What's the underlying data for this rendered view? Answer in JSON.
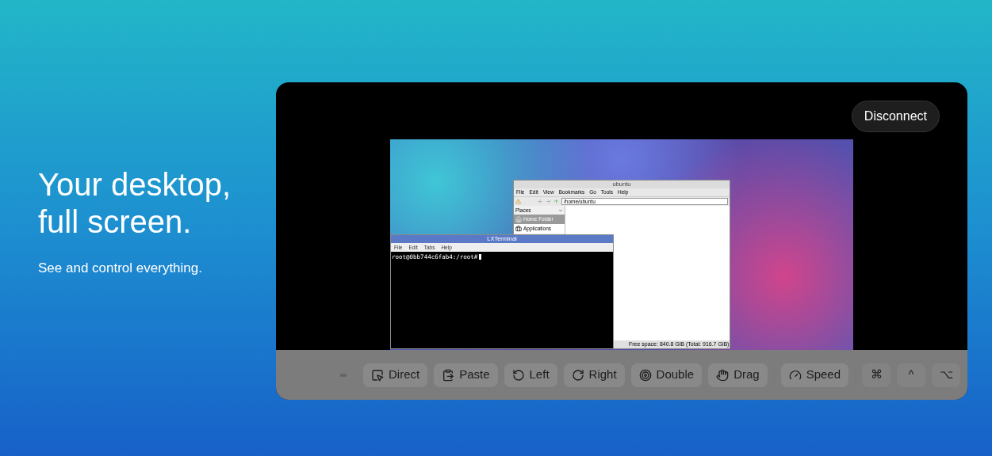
{
  "hero": {
    "title": "Your desktop, full screen.",
    "subtitle": "See and control everything."
  },
  "viewer": {
    "disconnect_button": "Disconnect",
    "remote_desktop": {
      "file_manager": {
        "title": "ubuntu",
        "menu": [
          "File",
          "Edit",
          "View",
          "Bookmarks",
          "Go",
          "Tools",
          "Help"
        ],
        "path": "/home/ubuntu",
        "places_header": "Places",
        "places": [
          {
            "label": "Home Folder",
            "selected": true
          },
          {
            "label": "Applications",
            "selected": false
          }
        ],
        "status": "Free space: 840.8 GiB (Total: 916.7 GiB)"
      },
      "terminal": {
        "title": "LXTerminal",
        "menu": [
          "File",
          "Edit",
          "Tabs",
          "Help"
        ],
        "prompt": "root@0bb744c6fab4:/root#"
      }
    },
    "toolbar": [
      {
        "kind": "keyboard"
      },
      {
        "kind": "action",
        "label": "Direct"
      },
      {
        "kind": "action",
        "label": "Paste"
      },
      {
        "kind": "action",
        "label": "Left"
      },
      {
        "kind": "action",
        "label": "Right"
      },
      {
        "kind": "action",
        "label": "Double"
      },
      {
        "kind": "action",
        "label": "Drag"
      },
      {
        "kind": "separator"
      },
      {
        "kind": "action",
        "label": "Speed"
      },
      {
        "kind": "separator"
      },
      {
        "kind": "key",
        "label": "⌘"
      },
      {
        "kind": "key",
        "label": "^"
      },
      {
        "kind": "key",
        "label": "⌥"
      }
    ]
  }
}
